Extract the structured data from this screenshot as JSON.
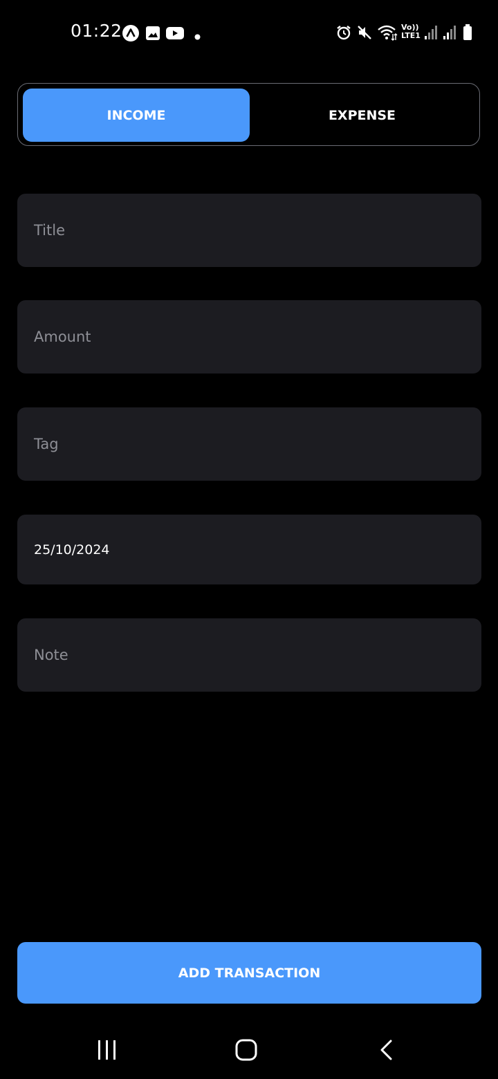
{
  "status_bar": {
    "time": "01:22",
    "left_icons": [
      "arch-app-icon",
      "gallery-icon",
      "youtube-icon",
      "notification-dot-icon"
    ],
    "right_icons": [
      "alarm-icon",
      "mute-icon",
      "wifi-icon",
      "volte-lte-icon",
      "signal-icon",
      "signal-icon-2",
      "battery-icon"
    ],
    "volte_top": "Vo))",
    "volte_bottom": "LTE1"
  },
  "type_toggle": {
    "income_label": "INCOME",
    "expense_label": "EXPENSE",
    "selected": "INCOME"
  },
  "form": {
    "title_placeholder": "Title",
    "amount_placeholder": "Amount",
    "tag_placeholder": "Tag",
    "date_value": "25/10/2024",
    "note_placeholder": "Note"
  },
  "actions": {
    "add_label": "ADD TRANSACTION"
  },
  "nav_bar": {
    "items": [
      "recents-icon",
      "home-icon",
      "back-icon"
    ]
  },
  "colors": {
    "accent": "#4a98fb",
    "background": "#000000",
    "field_background": "#1c1c21",
    "placeholder": "#8e8f96"
  }
}
